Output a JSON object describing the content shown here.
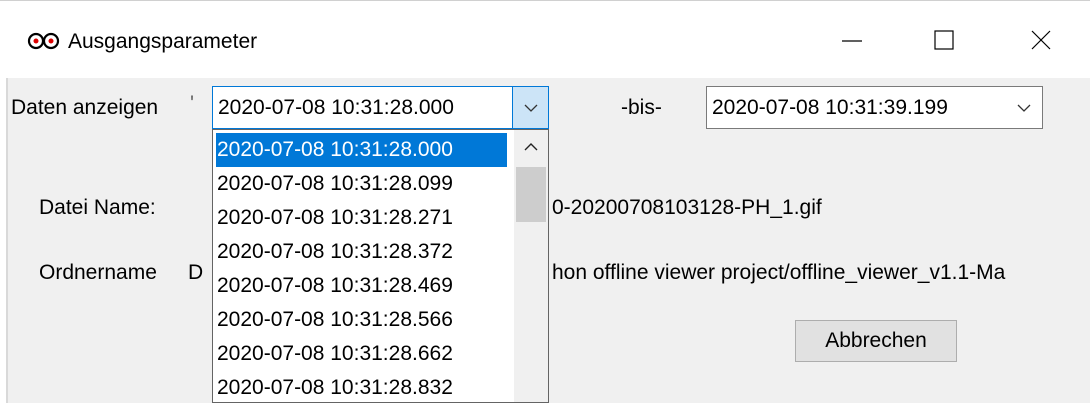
{
  "window": {
    "title": "Ausgangsparameter",
    "app_icon": "infinity-eyes-icon",
    "controls": [
      "minimize-icon",
      "maximize-icon",
      "close-icon"
    ]
  },
  "filter": {
    "label": "Daten anzeigen",
    "from_value": "2020-07-08 10:31:28.000",
    "to_label": "-bis-",
    "to_value": "2020-07-08 10:31:39.199"
  },
  "file": {
    "label": "Datei Name:",
    "value_visible": "0-20200708103128-PH_1.gif"
  },
  "folder": {
    "label": "Ordnername",
    "value_prefix_visible": "D",
    "value_visible": "hon offline viewer project/offline_viewer_v1.1-Ma"
  },
  "buttons": {
    "cancel": "Abbrechen"
  },
  "dropdown": {
    "items": [
      "2020-07-08 10:31:28.000",
      "2020-07-08 10:31:28.099",
      "2020-07-08 10:31:28.271",
      "2020-07-08 10:31:28.372",
      "2020-07-08 10:31:28.469",
      "2020-07-08 10:31:28.566",
      "2020-07-08 10:31:28.662",
      "2020-07-08 10:31:28.832"
    ],
    "selected_index": 0
  },
  "colors": {
    "accent": "#0078d7",
    "dropdown_button": "#cce4f7",
    "dialog_bg": "#f0f0f0"
  }
}
